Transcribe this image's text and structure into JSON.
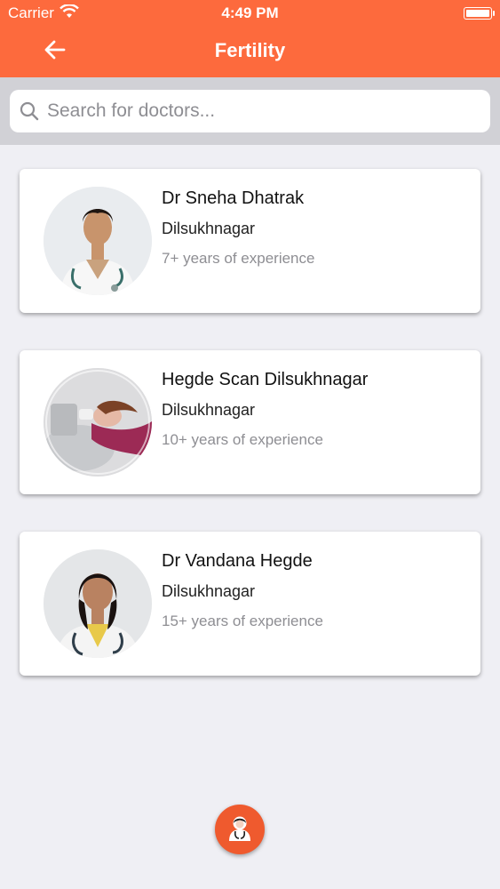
{
  "status_bar": {
    "carrier": "Carrier",
    "time": "4:49 PM"
  },
  "nav": {
    "title": "Fertility",
    "back_icon": "arrow-left-icon"
  },
  "search": {
    "placeholder": "Search for doctors...",
    "value": ""
  },
  "doctors": [
    {
      "name": "Dr Sneha Dhatrak",
      "location": "Dilsukhnagar",
      "experience": "7+ years of experience"
    },
    {
      "name": "Hegde Scan Dilsukhnagar",
      "location": "Dilsukhnagar",
      "experience": "10+ years of experience"
    },
    {
      "name": "Dr Vandana Hegde",
      "location": "Dilsukhnagar",
      "experience": "15+ years of experience"
    }
  ],
  "fab": {
    "icon": "doctor-avatar-icon"
  },
  "colors": {
    "accent": "#fd6a3d",
    "fab": "#ef5a2e",
    "background": "#efeff4",
    "search_area": "#d1d1d6"
  }
}
